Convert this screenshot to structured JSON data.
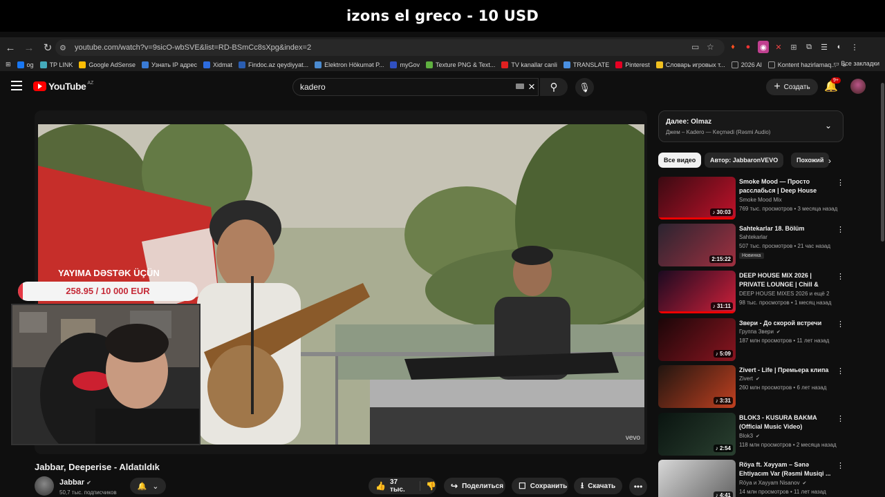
{
  "banner": {
    "text": "izons el greco - 10 USD"
  },
  "browser": {
    "url": "youtube.com/watch?v=9sicO-wbSVE&list=RD-BSmCc8sXpg&index=2",
    "bookmarks": [
      {
        "label": "og",
        "color": "#1877f2"
      },
      {
        "label": "TP LINK",
        "color": "#4ab"
      },
      {
        "label": "Google AdSense",
        "color": "#fbbc04"
      },
      {
        "label": "Узнать IP адрес",
        "color": "#3a7bd5"
      },
      {
        "label": "Xidmat",
        "color": "#2d6cdf"
      },
      {
        "label": "Findoc.az qeydiyyat...",
        "color": "#2a5db0"
      },
      {
        "label": "Elektron Hökumət P...",
        "color": "#4b8bd0"
      },
      {
        "label": "myGov",
        "color": "#3050c0"
      },
      {
        "label": "Texture PNG & Text...",
        "color": "#5fb040"
      },
      {
        "label": "TV kanallar canli",
        "color": "#e02020"
      },
      {
        "label": "TRANSLATE",
        "color": "#4a90e2"
      },
      {
        "label": "Pinterest",
        "color": "#e60023"
      },
      {
        "label": "Словарь игровых т...",
        "color": "#f0c020"
      },
      {
        "label": "2026 Al",
        "color": "#999"
      },
      {
        "label": "Kontent hazirlamaq...",
        "color": "#999"
      }
    ],
    "bookmarks_more": "»",
    "bookmarks_all": "Все закладки"
  },
  "youtube": {
    "logo_text": "YouTube",
    "region": "AZ",
    "search_value": "kadero",
    "create_label": "Создать",
    "notif_count": "9+"
  },
  "overlay": {
    "donate_title": "YAYIMA DƏSTƏK ÜÇÜN",
    "donate_amount": "258.95 / 10 000 EUR",
    "donate_progress": 0.026
  },
  "video": {
    "title": "Jabbar, Deeperise - Aldatıldık",
    "watermark": "vevo",
    "channel": "Jabbar",
    "subscribers": "50,7 тыс. подписчиков",
    "likes": "37 тыс.",
    "share_label": "Поделиться",
    "save_label": "Сохранить",
    "download_label": "Скачать"
  },
  "sidebar": {
    "upnext_title": "Далее: Olmaz",
    "upnext_sub": "Джем – Kadero — Keçmədi (Rəsmi Audio)",
    "chips": [
      "Все видео",
      "Автор: JabbaronVEVO",
      "Похожий"
    ],
    "recommendations": [
      {
        "title": "Smoke Mood — Просто расслабься | Deep House мик...",
        "channel": "Smoke Mood Mix",
        "meta": "769 тыс. просмотров • 3 месяца назад",
        "duration": "30:03",
        "music": true,
        "verified": false,
        "badge": "",
        "colors": [
          "#3a0a12",
          "#c0122a"
        ]
      },
      {
        "title": "Sahtekarlar 18. Bölüm",
        "channel": "Sahtekarlar",
        "meta": "507 тыс. просмотров • 21 час назад",
        "duration": "2:15:22",
        "music": false,
        "verified": false,
        "badge": "Новинка",
        "colors": [
          "#2a2430",
          "#a03040"
        ]
      },
      {
        "title": "DEEP HOUSE MIX 2026 | PRIVATE LOUNGE | Chill & Relax",
        "channel": "DEEP HOUSE MIXES 2026 и ещё 2",
        "meta": "98 тыс. просмотров • 1 месяц назад",
        "duration": "31:11",
        "music": true,
        "verified": false,
        "badge": "",
        "colors": [
          "#1a0a20",
          "#d0203a"
        ]
      },
      {
        "title": "Звери - До скорой встречи",
        "channel": "Группа Звери",
        "meta": "187 млн просмотров • 11 лет назад",
        "duration": "5:09",
        "music": true,
        "verified": true,
        "badge": "",
        "colors": [
          "#1a0608",
          "#8a1520"
        ]
      },
      {
        "title": "Zivert - Life | Премьера клипа",
        "channel": "Zivert",
        "meta": "260 млн просмотров • 6 лет назад",
        "duration": "3:31",
        "music": true,
        "verified": true,
        "badge": "",
        "colors": [
          "#201510",
          "#c04020"
        ]
      },
      {
        "title": "BLOK3 - KUSURA BAKMA (Official Music Video)",
        "channel": "Blok3",
        "meta": "118 млн просмотров • 2 месяца назад",
        "duration": "2:54",
        "music": true,
        "verified": true,
        "badge": "",
        "colors": [
          "#0a1410",
          "#2a4030"
        ]
      },
      {
        "title": "Röya ft. Xəyyam – Sənə Ehtiyacım Var (Rəsmi Musiqi ...",
        "channel": "Röya и Xayyam Nisanov",
        "meta": "14 млн просмотров • 11 лет назад",
        "duration": "4:41",
        "music": true,
        "verified": true,
        "badge": "",
        "colors": [
          "#d8d8d8",
          "#606060"
        ]
      }
    ]
  }
}
